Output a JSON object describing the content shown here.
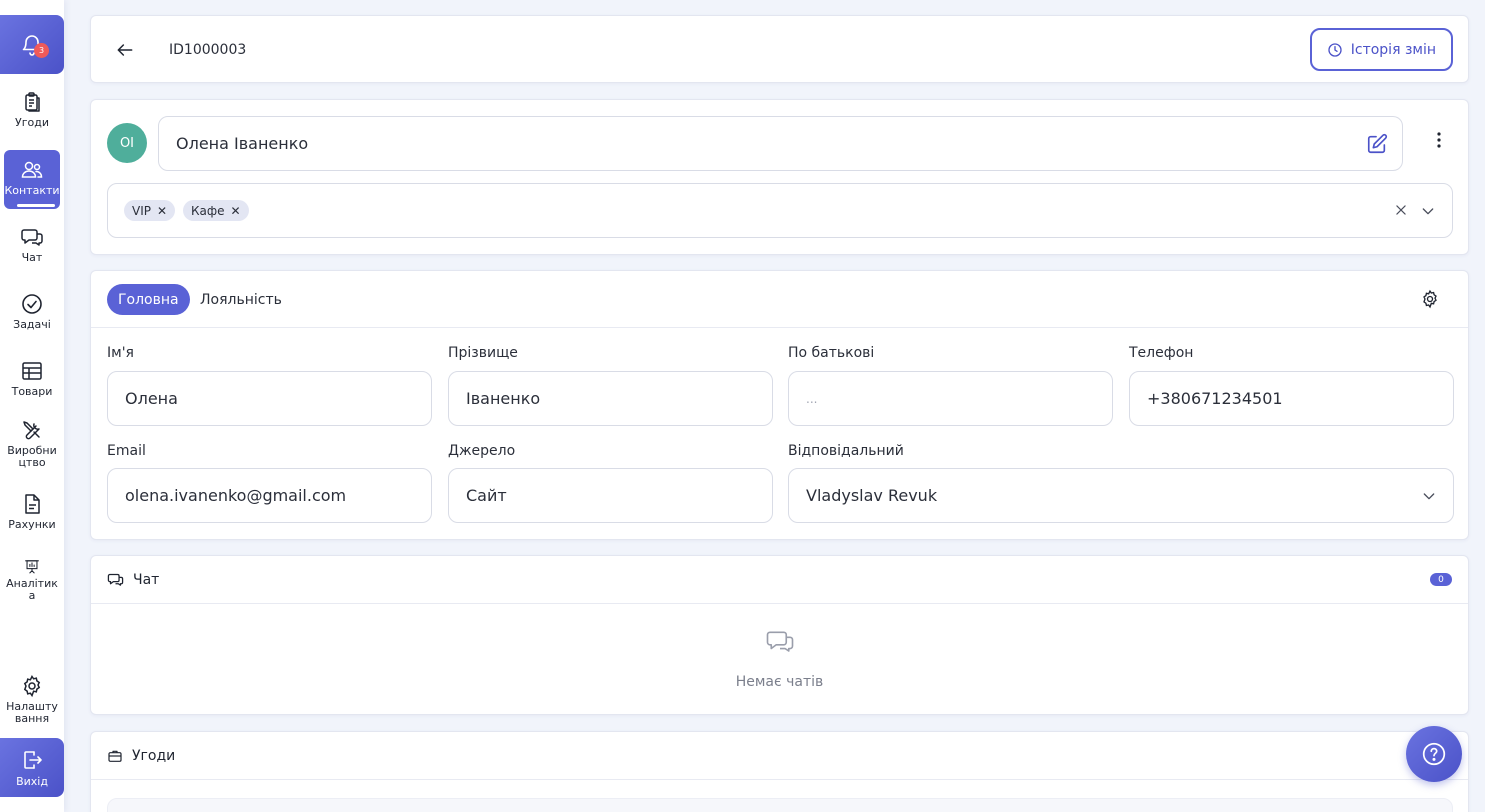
{
  "sidebar": {
    "notifications_count": "3",
    "items": [
      {
        "label": "Угоди",
        "icon": "clipboard-icon"
      },
      {
        "label": "Контакти",
        "icon": "users-icon"
      },
      {
        "label": "Чат",
        "icon": "chat-icon"
      },
      {
        "label": "Задачі",
        "icon": "check-circle-icon"
      },
      {
        "label": "Товари",
        "icon": "table-icon"
      },
      {
        "label": "Виробництво",
        "icon": "tools-icon"
      },
      {
        "label": "Рахунки",
        "icon": "document-icon"
      },
      {
        "label": "Аналітика",
        "icon": "presentation-chart-icon"
      },
      {
        "label": "Налаштування",
        "icon": "gear-icon"
      }
    ],
    "active_item": "Контакти",
    "logout_label": "Вихід"
  },
  "header": {
    "record_id": "ID1000003",
    "history_label": "Історія змін"
  },
  "contact": {
    "initials": "ОІ",
    "full_name": "Олена Іваненко",
    "tags": [
      "VIP",
      "Кафе"
    ]
  },
  "tabs": [
    {
      "label": "Головна",
      "active": true
    },
    {
      "label": "Лояльність",
      "active": false
    }
  ],
  "form": {
    "first_name": {
      "label": "Ім'я",
      "value": "Олена"
    },
    "last_name": {
      "label": "Прізвище",
      "value": "Іваненко"
    },
    "middle_name": {
      "label": "По батькові",
      "placeholder": "..."
    },
    "phone": {
      "label": "Телефон",
      "value": "+380671234501"
    },
    "email": {
      "label": "Email",
      "value": "olena.ivanenko@gmail.com"
    },
    "source": {
      "label": "Джерело",
      "value": "Сайт"
    },
    "responsible": {
      "label": "Відповідальний",
      "value": "Vladyslav Revuk"
    }
  },
  "chat_section": {
    "title": "Чат",
    "count": "0",
    "empty_text": "Немає чатів"
  },
  "deals_section": {
    "title": "Угоди"
  },
  "colors": {
    "accent": "#5a62d6",
    "avatar": "#4fae9b",
    "badge": "#ef5a5a"
  }
}
